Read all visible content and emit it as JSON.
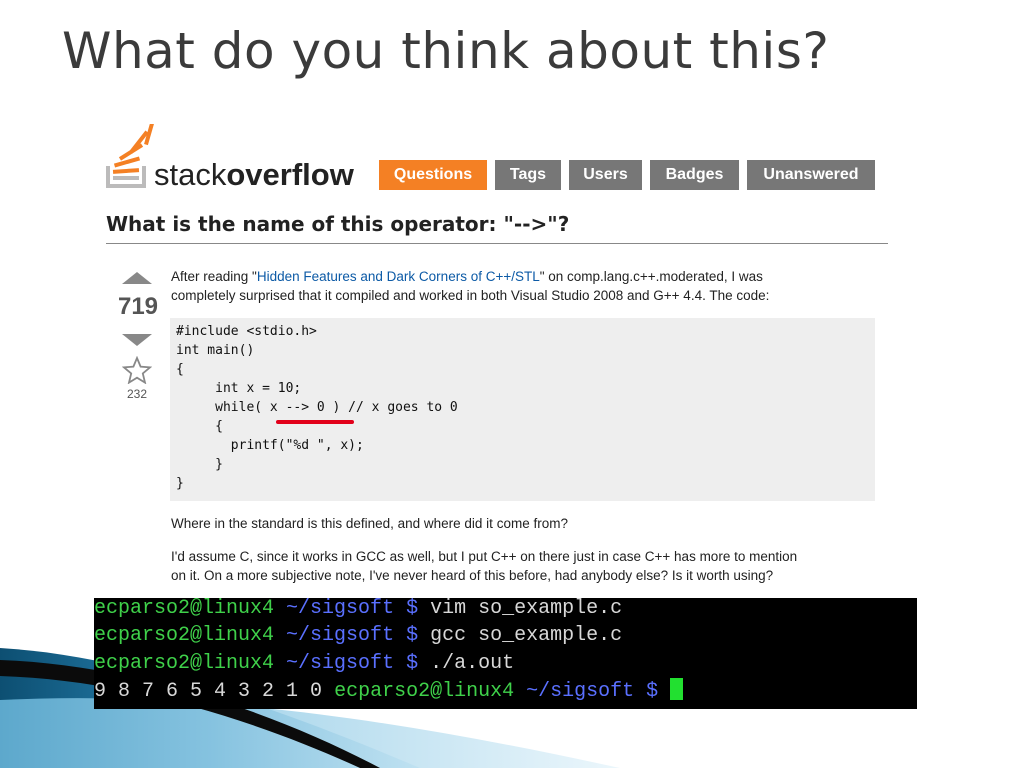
{
  "slide": {
    "title": "What do you think about this?"
  },
  "so_header": {
    "logo_text_light": "stack",
    "logo_text_bold": "overflow",
    "nav": [
      {
        "label": "Questions",
        "active": true
      },
      {
        "label": "Tags",
        "active": false
      },
      {
        "label": "Users",
        "active": false
      },
      {
        "label": "Badges",
        "active": false
      },
      {
        "label": "Unanswered",
        "active": false
      }
    ]
  },
  "question": {
    "title": "What is the name of this operator: \"-->\"?",
    "votes": "719",
    "favorites": "232",
    "intro_before_link": "After reading \"",
    "intro_link": "Hidden Features and Dark Corners of C++/STL",
    "intro_after_link": "\" on comp.lang.c++.moderated, I was",
    "intro_line2": "completely surprised that it compiled and worked in both Visual Studio 2008 and G++ 4.4. The code:",
    "code": [
      "#include <stdio.h>",
      "int main()",
      "{",
      "     int x = 10;",
      "     while( x --> 0 ) // x goes to 0",
      "     {",
      "       printf(\"%d \", x);",
      "     }",
      "}"
    ],
    "followup": "Where in the standard is this defined, and where did it come from?",
    "closing_line1": "I'd assume C, since it works in GCC as well, but I put C++ on there just in case C++ has more to mention",
    "closing_line2": "on it. On a more subjective note, I've never heard of this before, had anybody else? Is it worth using?"
  },
  "terminal": {
    "lines": [
      {
        "host": "ecparso2@linux4",
        "path": "~/sigsoft $",
        "cmd": "vim so_example.c"
      },
      {
        "host": "ecparso2@linux4",
        "path": "~/sigsoft $",
        "cmd": "gcc so_example.c"
      },
      {
        "host": "ecparso2@linux4",
        "path": "~/sigsoft $",
        "cmd": "./a.out"
      }
    ],
    "output": "9 8 7 6 5 4 3 2 1 0",
    "final_host": "ecparso2@linux4",
    "final_path": "~/sigsoft $"
  },
  "colors": {
    "nav_active": "#f48024",
    "nav_inactive": "#777777",
    "link": "#0c5aa6",
    "highlight_underline": "#e2001a",
    "terminal_prompt": "#3fd14a",
    "terminal_path": "#5a70ff"
  },
  "icons": [
    "stackoverflow-logo-icon",
    "vote-up-icon",
    "vote-down-icon",
    "favorite-star-icon",
    "terminal-cursor-icon"
  ]
}
